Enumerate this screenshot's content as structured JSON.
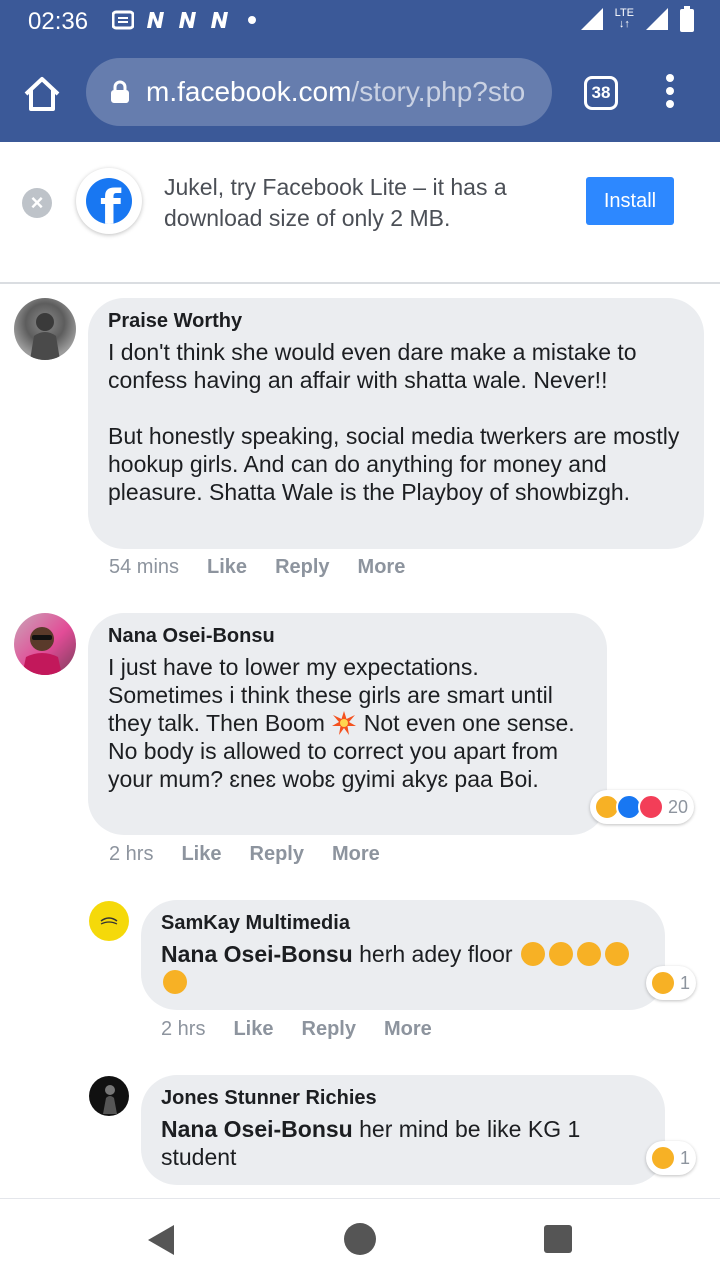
{
  "status": {
    "time": "02:36",
    "network": "LTE"
  },
  "browser": {
    "domain": "m.facebook.com",
    "path": "/story.php?sto",
    "tab_count": "38"
  },
  "banner": {
    "close": "×",
    "logo_letter": "f",
    "text": "Jukel, try Facebook Lite – it has a download size of only 2 MB.",
    "install_label": "Install"
  },
  "comments": [
    {
      "author": "Praise Worthy",
      "text": "I don't think she would even dare make a mistake to confess having an affair with shatta wale. Never!!\n\nBut honestly speaking, social media twerkers are mostly hookup girls. And can do anything for money and pleasure. Shatta Wale is the Playboy of showbizgh.",
      "time": "54 mins",
      "like": "Like",
      "reply": "Reply",
      "more": "More"
    },
    {
      "author": "Nana Osei-Bonsu",
      "text_before": "I just have to lower my expectations. Sometimes i think these girls are smart until they talk. Then Boom ",
      "text_after": " Not even one sense. No body is allowed to correct you apart from your mum? ɛneɛ wobɛ gyimi akyɛ paa Boi.",
      "reaction_count": "20",
      "time": "2 hrs",
      "like": "Like",
      "reply": "Reply",
      "more": "More"
    }
  ],
  "replies": [
    {
      "author": "SamKay Multimedia",
      "mention": "Nana Osei-Bonsu",
      "text": " herh adey floor ",
      "reaction_count": "1",
      "time": "2 hrs",
      "like": "Like",
      "reply": "Reply",
      "more": "More"
    },
    {
      "author": "Jones Stunner Richies",
      "mention": "Nana Osei-Bonsu",
      "text": " her mind be like KG 1 student",
      "reaction_count": "1"
    }
  ],
  "icons": {
    "status": [
      "message-icon",
      "n-icon",
      "n-icon",
      "n-icon",
      "signal-icon",
      "battery-icon"
    ],
    "reactions": [
      "haha-icon",
      "like-icon",
      "love-icon"
    ],
    "nav": [
      "back-icon",
      "home-icon",
      "recents-icon"
    ]
  },
  "colors": {
    "brand": "#3b5998",
    "button": "#2d88ff",
    "bubble": "#ebedf0",
    "secondary_text": "#8d949e"
  }
}
